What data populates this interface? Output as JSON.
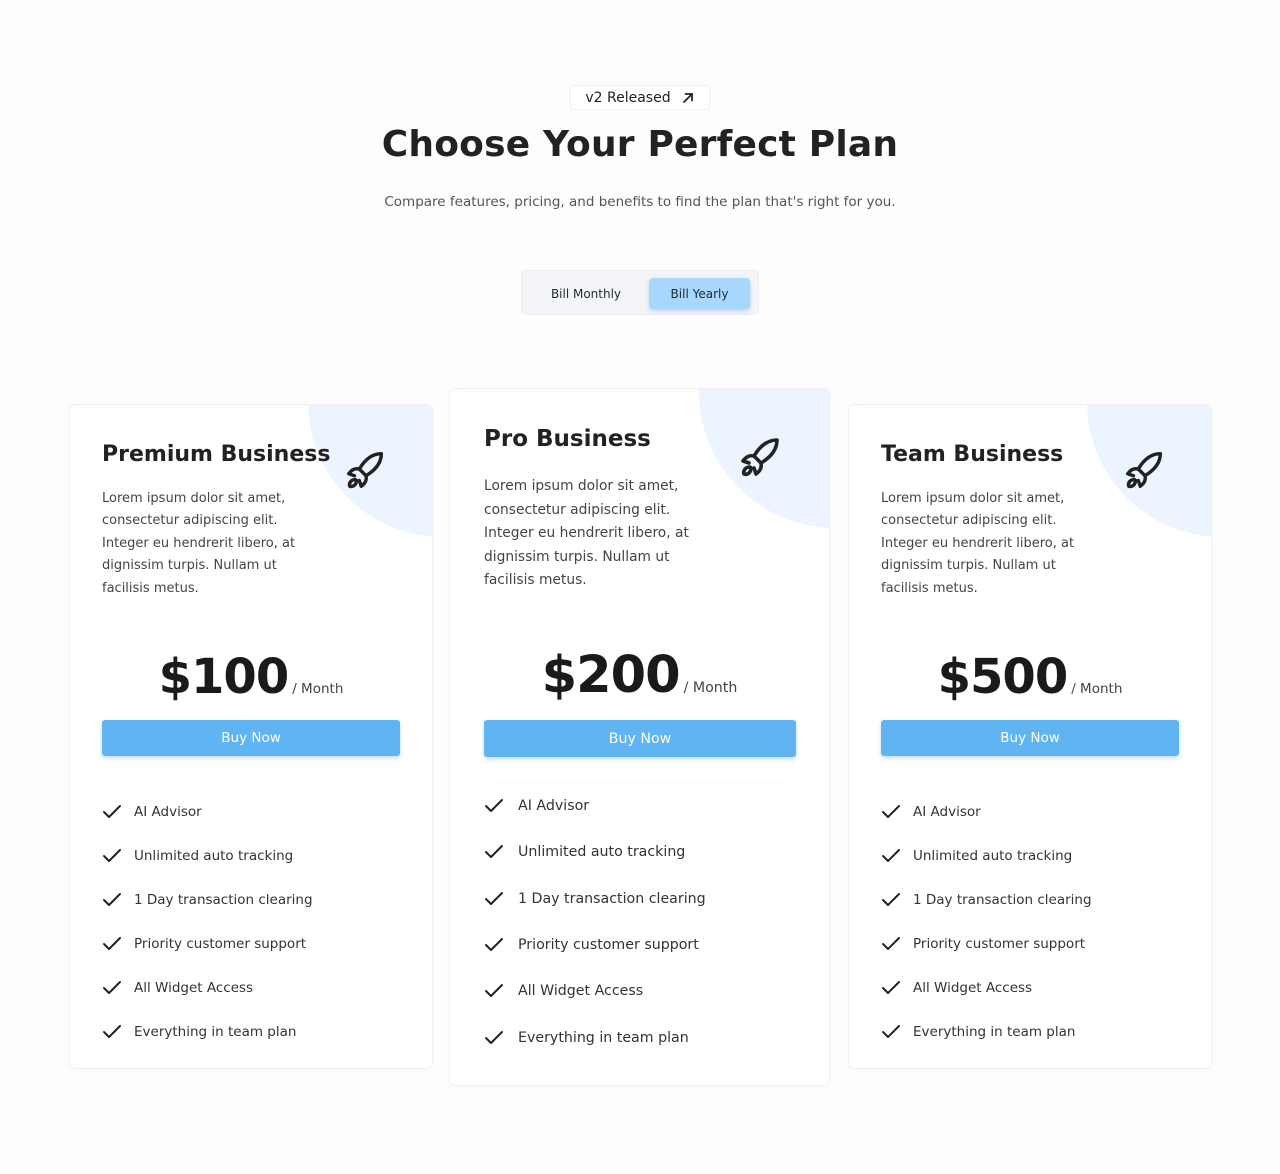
{
  "header": {
    "badge_label": "v2 Released",
    "title": "Choose Your Perfect Plan",
    "subtitle": "Compare features, pricing, and benefits to find the plan that's right for you."
  },
  "billing_toggle": {
    "options": [
      "Bill Monthly",
      "Bill Yearly"
    ],
    "selected": "Bill Yearly"
  },
  "plans": [
    {
      "name": "Premium Business",
      "description": "Lorem ipsum dolor sit amet, consectetur adipiscing elit. Integer eu hendrerit libero, at dignissim turpis. Nullam ut facilisis metus.",
      "price": "$100",
      "period": "/ Month",
      "cta": "Buy Now",
      "icon": "rocket-icon",
      "features": [
        "AI Advisor",
        "Unlimited auto tracking",
        "1 Day transaction clearing",
        "Priority customer support",
        "All Widget Access",
        "Everything in team plan"
      ]
    },
    {
      "name": "Pro Business",
      "description": "Lorem ipsum dolor sit amet, consectetur adipiscing elit. Integer eu hendrerit libero, at dignissim turpis. Nullam ut facilisis metus.",
      "price": "$200",
      "period": "/ Month",
      "cta": "Buy Now",
      "icon": "rocket-icon",
      "features": [
        "AI Advisor",
        "Unlimited auto tracking",
        "1 Day transaction clearing",
        "Priority customer support",
        "All Widget Access",
        "Everything in team plan"
      ]
    },
    {
      "name": "Team Business",
      "description": "Lorem ipsum dolor sit amet, consectetur adipiscing elit. Integer eu hendrerit libero, at dignissim turpis. Nullam ut facilisis metus.",
      "price": "$500",
      "period": "/ Month",
      "cta": "Buy Now",
      "icon": "rocket-icon",
      "features": [
        "AI Advisor",
        "Unlimited auto tracking",
        "1 Day transaction clearing",
        "Priority customer support",
        "All Widget Access",
        "Everything in team plan"
      ]
    }
  ],
  "colors": {
    "accent": "#5fb4f1",
    "toggle_selected": "#a9d6fb",
    "blob": "#ecf5ff",
    "text_dark": "#222222"
  }
}
